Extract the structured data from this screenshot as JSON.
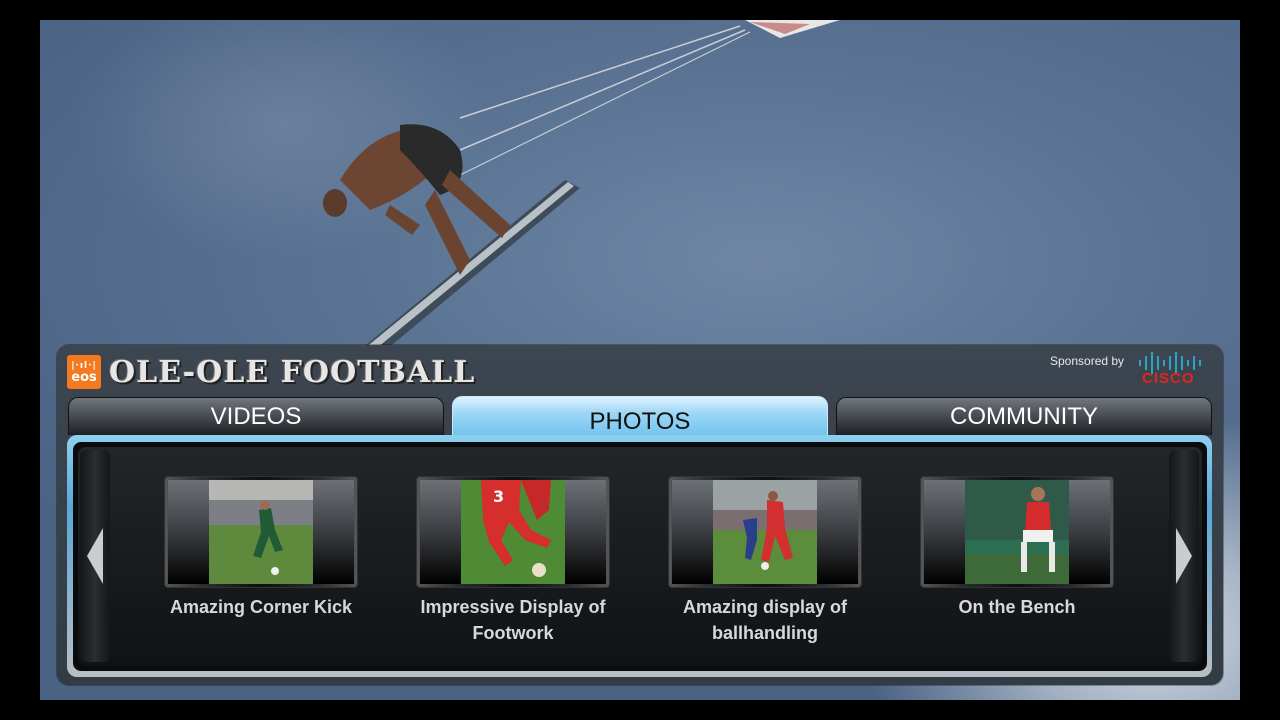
{
  "brand": {
    "logo_text": "eos",
    "title": "OLE-OLE FOOTBALL"
  },
  "sponsor": {
    "label": "Sponsored by",
    "name": "CISCO"
  },
  "tabs": [
    {
      "label": "VIDEOS",
      "active": false
    },
    {
      "label": "PHOTOS",
      "active": true
    },
    {
      "label": "COMMUNITY",
      "active": false
    }
  ],
  "photos": [
    {
      "caption": "Amazing Corner Kick"
    },
    {
      "caption": "Impressive Display of Footwork"
    },
    {
      "caption": "Amazing display of ballhandling"
    },
    {
      "caption": "On the Bench"
    }
  ],
  "colors": {
    "active_tab": "#9ad5f5",
    "brand_orange": "#f47a20",
    "cisco_red": "#e1251b"
  }
}
